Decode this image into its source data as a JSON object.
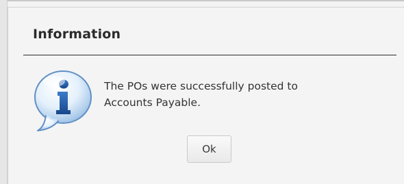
{
  "dialog": {
    "title": "Information",
    "message_line1": "The POs were successfully posted to",
    "message_line2": "Accounts Payable.",
    "ok_label": "Ok",
    "icon": "info-icon",
    "colors": {
      "icon_blue": "#1e5aa8",
      "title_text": "#2b2b2b",
      "divider": "#2a2a2a"
    }
  }
}
